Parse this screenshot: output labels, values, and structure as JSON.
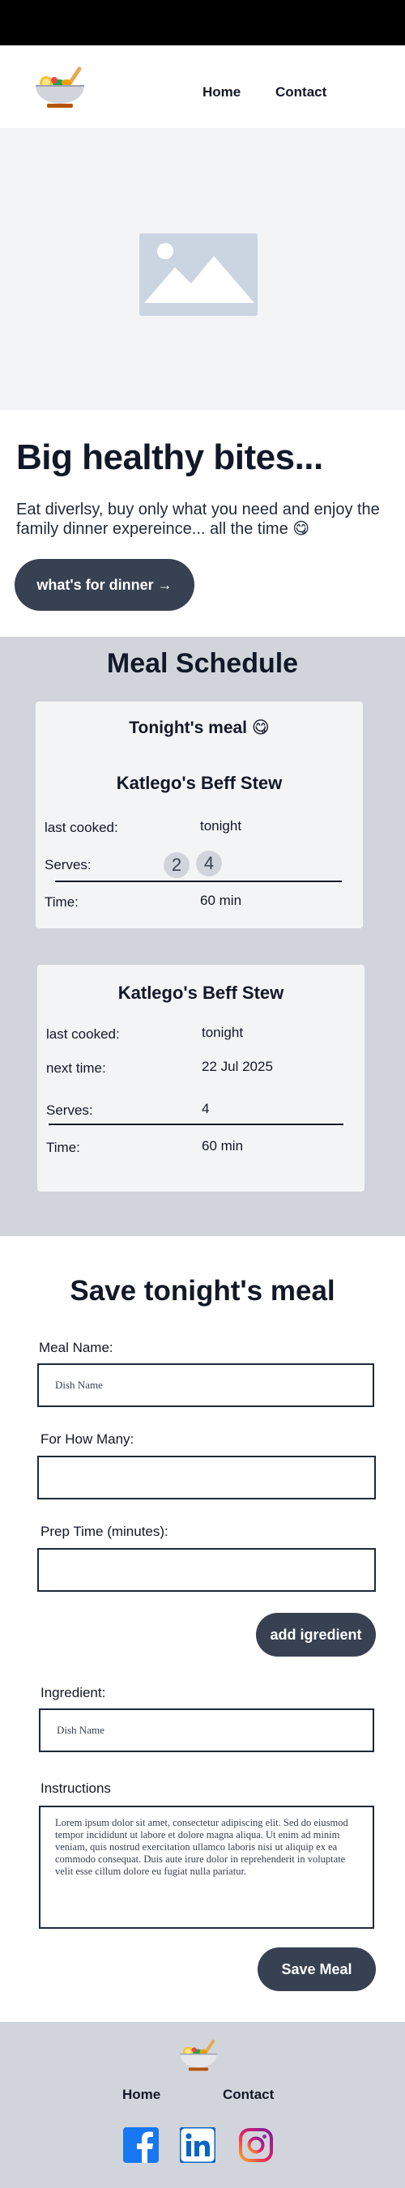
{
  "nav": {
    "home": "Home",
    "contact": "Contact"
  },
  "hero": {
    "title": "Big healthy bites...",
    "text": "Eat diverlsy, buy only what you need and enjoy the family dinner expereince... all the time 😋",
    "button": "what's for dinner →"
  },
  "schedule": {
    "title": "Meal Schedule",
    "tonight": {
      "subtitle": "Tonight's meal 😋",
      "name": "Katlego's Beff Stew",
      "last_cooked_label": "last cooked:",
      "last_cooked_value": "tonight",
      "serves_label": "Serves:",
      "serve_options": [
        "2",
        "4"
      ],
      "time_label": "Time:",
      "time_value": "60 min"
    },
    "next": {
      "name": "Katlego's Beff Stew",
      "last_cooked_label": "last cooked:",
      "last_cooked_value": "tonight",
      "next_time_label": "next time:",
      "next_time_value": "22 Jul 2025",
      "serves_label": "Serves:",
      "serves_value": "4",
      "time_label": "Time:",
      "time_value": "60 min"
    }
  },
  "form": {
    "title": "Save tonight's meal",
    "meal_name_label": "Meal Name:",
    "meal_name_placeholder": "Dish  Name",
    "how_many_label": "For How Many:",
    "prep_time_label": "Prep Time (minutes):",
    "add_ingredient_button": "add igredient",
    "ingredient_label": "Ingredient:",
    "ingredient_placeholder": "Dish  Name",
    "instructions_label": "Instructions",
    "instructions_text": "Lorem ipsum dolor sit amet, consectetur adipiscing elit. Sed do eiusmod tempor incididunt ut labore et dolore magna aliqua. Ut enim ad minim veniam, quis nostrud exercitation ullamco laboris nisi ut aliquip ex ea commodo consequat. Duis aute irure dolor in reprehenderit in voluptate velit esse cillum dolore eu fugiat nulla pariatur.",
    "save_button": "Save Meal"
  },
  "footer": {
    "home": "Home",
    "contact": "Contact"
  },
  "icons": [
    "bowl-logo-icon",
    "image-placeholder-icon",
    "facebook-icon",
    "linkedin-icon",
    "instagram-icon"
  ],
  "colors": {
    "accent": "#374151",
    "section_bg": "#d1d5db",
    "card_bg": "#f3f4f6",
    "facebook": "#1877f2",
    "linkedin": "#0a66c2"
  }
}
